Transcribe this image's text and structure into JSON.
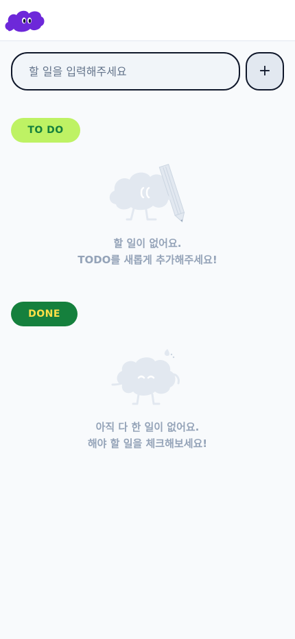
{
  "header": {
    "logo_icon": "cloud-eyes-logo-icon"
  },
  "input": {
    "placeholder": "할 일을 입력해주세요",
    "value": ""
  },
  "add_button": {
    "label": "+",
    "icon": "plus-icon"
  },
  "todo_section": {
    "badge": "TO DO",
    "empty_line1": "할 일이 없어요.",
    "empty_line2": "TODO를 새롭게 추가해주세요!",
    "illustration": "cloud-with-pencil-illustration"
  },
  "done_section": {
    "badge": "DONE",
    "empty_line1": "아직 다 한 일이 없어요.",
    "empty_line2": "해야 할 일을 체크해보세요!",
    "illustration": "sleepy-cloud-illustration"
  },
  "colors": {
    "background": "#F8FAFC",
    "logo": "#6D28D9",
    "todo_badge_bg": "#BEF264",
    "todo_badge_text": "#15803D",
    "done_badge_bg": "#15803D",
    "done_badge_text": "#FDE047",
    "empty_text": "#94A3B8"
  }
}
